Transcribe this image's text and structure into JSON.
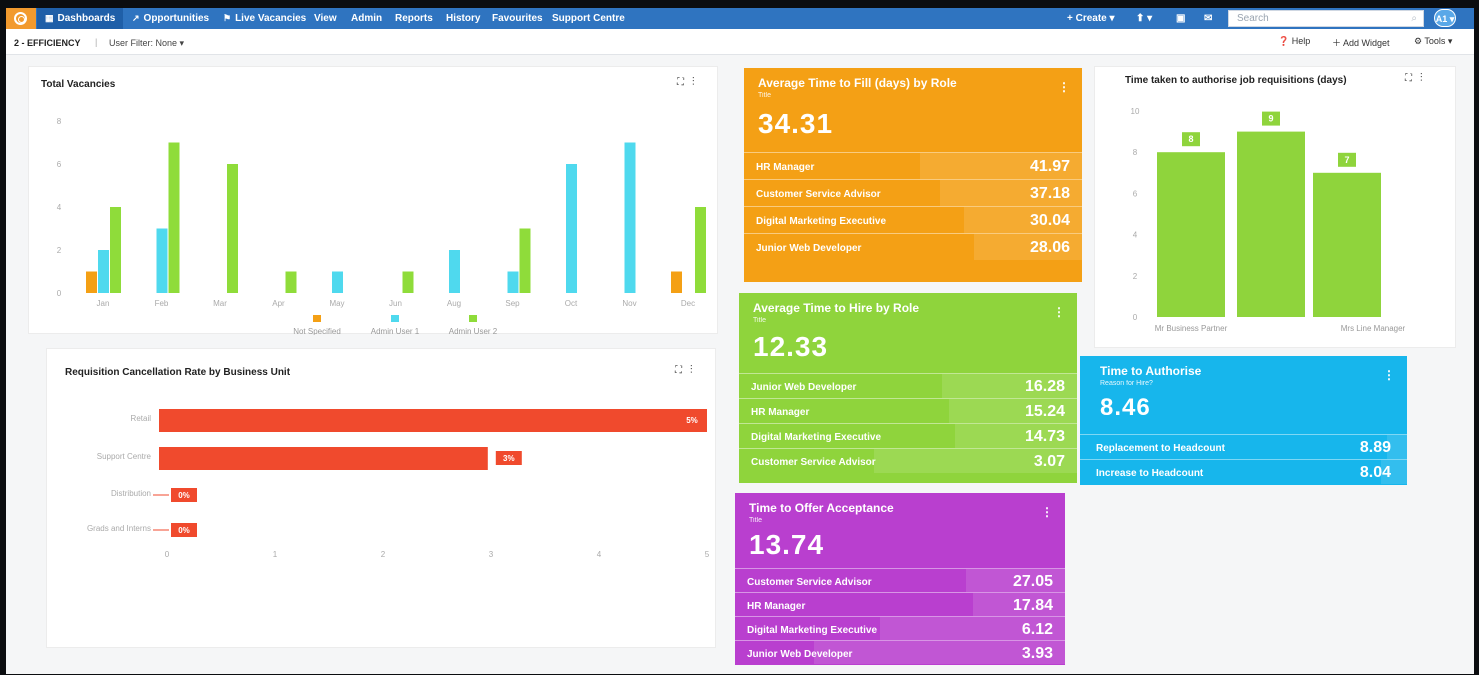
{
  "colors": {
    "nav_bg": "#2f74c0",
    "logo_bg": "#f29a2e",
    "orange": "#f4a015",
    "green": "#8fd43c",
    "purple": "#b93fcf",
    "blue": "#17b6ec",
    "red": "#f04a2d",
    "series_not_specified": "#f4a015",
    "series_admin_1": "#4fd9ee",
    "series_admin_2": "#8fdc3a"
  },
  "nav": {
    "items": [
      {
        "label": "Dashboards",
        "icon": "grid-icon"
      },
      {
        "label": "Opportunities",
        "icon": "trend-icon"
      },
      {
        "label": "Live Vacancies",
        "icon": "flag-icon"
      },
      {
        "label": "View"
      },
      {
        "label": "Admin"
      },
      {
        "label": "Reports"
      },
      {
        "label": "History"
      },
      {
        "label": "Favourites"
      },
      {
        "label": "Support Centre"
      }
    ],
    "create_label": "+ Create ▾",
    "upload_label": "⬆ ▾",
    "search_placeholder": "Search",
    "avatar_initials": "A1 ▾"
  },
  "subbar": {
    "dashboard_name": "2 - EFFICIENCY",
    "separator": "|",
    "user_filter": "User Filter: None ▾",
    "help": "Help",
    "add_widget": "Add Widget",
    "tools": "Tools ▾"
  },
  "total_vacancies": {
    "title": "Total Vacancies",
    "chart_data": {
      "type": "bar",
      "categories": [
        "Jan",
        "Feb",
        "Mar",
        "Apr",
        "May",
        "Jun",
        "Aug",
        "Sep",
        "Oct",
        "Nov",
        "Dec"
      ],
      "ylim": [
        0,
        8
      ],
      "yticks": [
        "0",
        "2",
        "4",
        "6",
        "8"
      ],
      "series": [
        {
          "name": "Not Specified",
          "values": [
            1,
            0,
            0,
            0,
            0,
            0,
            0,
            0,
            0,
            0,
            1
          ]
        },
        {
          "name": "Admin User 1",
          "values": [
            2,
            3,
            0,
            0,
            1,
            0,
            2,
            1,
            6,
            7,
            0
          ]
        },
        {
          "name": "Admin User 2",
          "values": [
            4,
            7,
            6,
            1,
            0,
            1,
            0,
            3,
            0,
            0,
            4
          ]
        }
      ]
    }
  },
  "cancellation": {
    "title": "Requisition Cancellation Rate by Business Unit",
    "chart_data": {
      "type": "bar",
      "orientation": "horizontal",
      "categories": [
        "Retail",
        "Support Centre",
        "Distribution",
        "Grads and Interns"
      ],
      "values": [
        5,
        3,
        0,
        0
      ],
      "value_labels": [
        "5%",
        "3%",
        "0%",
        "0%"
      ],
      "xlim": [
        0,
        5
      ],
      "xticks": [
        "0",
        "1",
        "2",
        "3",
        "4",
        "5"
      ]
    }
  },
  "authorise_chart": {
    "title": "Time taken to authorise job requisitions (days)",
    "chart_data": {
      "type": "bar",
      "categories": [
        "Mr Business Partner",
        "",
        "Mrs Line Manager"
      ],
      "values": [
        8,
        9,
        7
      ],
      "value_labels": [
        "8",
        "9",
        "7"
      ],
      "ylim": [
        0,
        10
      ],
      "yticks": [
        "0",
        "2",
        "4",
        "6",
        "8",
        "10"
      ]
    }
  },
  "kpi_fill": {
    "title": "Average Time to Fill (days) by Role",
    "subtitle": "Title",
    "value": "34.31",
    "rows": [
      {
        "label": "HR Manager",
        "value": "41.97"
      },
      {
        "label": "Customer Service Advisor",
        "value": "37.18"
      },
      {
        "label": "Digital Marketing Executive",
        "value": "30.04"
      },
      {
        "label": "Junior Web Developer",
        "value": "28.06"
      }
    ]
  },
  "kpi_hire": {
    "title": "Average Time to Hire by Role",
    "subtitle": "Title",
    "value": "12.33",
    "rows": [
      {
        "label": "Junior Web Developer",
        "value": "16.28"
      },
      {
        "label": "HR Manager",
        "value": "15.24"
      },
      {
        "label": "Digital Marketing Executive",
        "value": "14.73"
      },
      {
        "label": "Customer Service Advisor",
        "value": "3.07"
      }
    ]
  },
  "kpi_offer": {
    "title": "Time to Offer Acceptance",
    "subtitle": "Title",
    "value": "13.74",
    "rows": [
      {
        "label": "Customer Service Advisor",
        "value": "27.05"
      },
      {
        "label": "HR Manager",
        "value": "17.84"
      },
      {
        "label": "Digital Marketing Executive",
        "value": "6.12"
      },
      {
        "label": "Junior Web Developer",
        "value": "3.93"
      }
    ]
  },
  "kpi_authorise": {
    "title": "Time to Authorise",
    "subtitle": "Reason for Hire?",
    "value": "8.46",
    "rows": [
      {
        "label": "Replacement to Headcount",
        "value": "8.89"
      },
      {
        "label": "Increase to Headcount",
        "value": "8.04"
      }
    ]
  }
}
